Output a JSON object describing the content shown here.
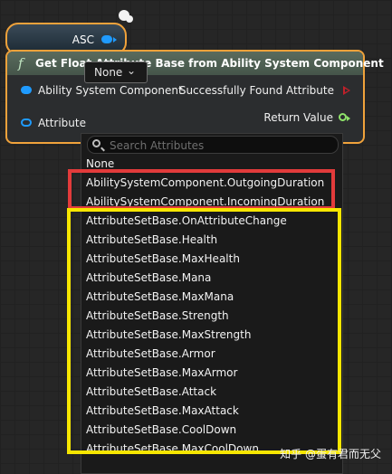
{
  "variable_node": {
    "label": "ASC"
  },
  "function_node": {
    "title": "Get Float Attribute Base from Ability System Component",
    "inputs": {
      "asc_label": "Ability System Component",
      "attribute_label": "Attribute",
      "attribute_value": "None"
    },
    "outputs": {
      "found_label": "Successfully Found Attribute",
      "return_label": "Return Value"
    }
  },
  "dropdown": {
    "search_placeholder": "Search Attributes",
    "options": [
      "None",
      "AbilitySystemComponent.OutgoingDuration",
      "AbilitySystemComponent.IncomingDuration",
      "AttributeSetBase.OnAttributeChange",
      "AttributeSetBase.Health",
      "AttributeSetBase.MaxHealth",
      "AttributeSetBase.Mana",
      "AttributeSetBase.MaxMana",
      "AttributeSetBase.Strength",
      "AttributeSetBase.MaxStrength",
      "AttributeSetBase.Armor",
      "AttributeSetBase.MaxArmor",
      "AttributeSetBase.Attack",
      "AttributeSetBase.MaxAttack",
      "AttributeSetBase.CoolDown",
      "AttributeSetBase.MaxCoolDown"
    ]
  },
  "watermark": "知乎 @蛋有君而无父",
  "colors": {
    "node_border": "#f0a23b",
    "object_pin": "#1f9bff",
    "exec_pin": "#c0202a",
    "float_pin": "#8fe36a",
    "highlight_red": "#e23b3b",
    "highlight_yellow": "#f6e600"
  },
  "icons": {
    "function": "function-f-icon",
    "search": "search-icon",
    "chevron": "chevron-down-icon"
  }
}
